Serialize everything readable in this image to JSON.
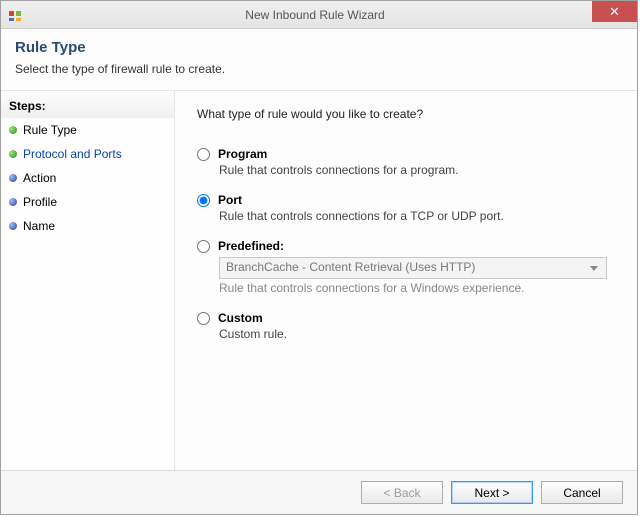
{
  "window": {
    "title": "New Inbound Rule Wizard",
    "close_glyph": "✕"
  },
  "header": {
    "title": "Rule Type",
    "description": "Select the type of firewall rule to create."
  },
  "sidebar": {
    "steps_label": "Steps:",
    "items": [
      {
        "label": "Rule Type",
        "bullet": "green",
        "link": false
      },
      {
        "label": "Protocol and Ports",
        "bullet": "green",
        "link": true
      },
      {
        "label": "Action",
        "bullet": "blue",
        "link": false
      },
      {
        "label": "Profile",
        "bullet": "blue",
        "link": false
      },
      {
        "label": "Name",
        "bullet": "blue",
        "link": false
      }
    ]
  },
  "content": {
    "prompt": "What type of rule would you like to create?",
    "options": {
      "program": {
        "label": "Program",
        "desc": "Rule that controls connections for a program.",
        "selected": false
      },
      "port": {
        "label": "Port",
        "desc": "Rule that controls connections for a TCP or UDP port.",
        "selected": true
      },
      "predefined": {
        "label": "Predefined:",
        "select_value": "BranchCache - Content Retrieval (Uses HTTP)",
        "desc": "Rule that controls connections for a Windows experience.",
        "selected": false,
        "disabled": true
      },
      "custom": {
        "label": "Custom",
        "desc": "Custom rule.",
        "selected": false
      }
    }
  },
  "footer": {
    "back": "< Back",
    "next": "Next >",
    "cancel": "Cancel"
  }
}
